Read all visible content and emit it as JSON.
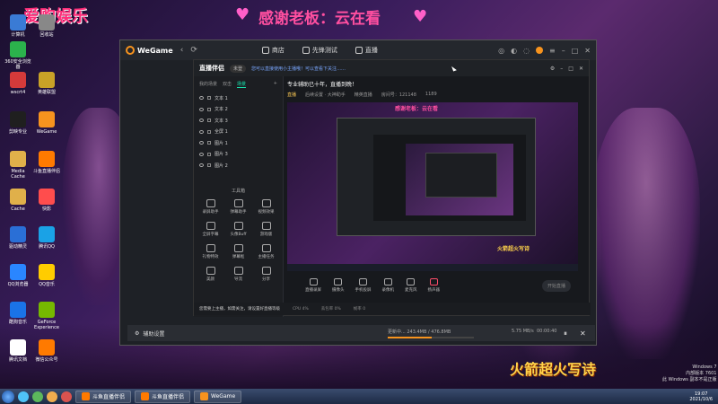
{
  "banners": {
    "left": "爱购娱乐",
    "center": "感谢老板：云在看",
    "right": "火箭超火写诗"
  },
  "desktop_icons": [
    {
      "label": "计算机",
      "color": "#3a7bd5"
    },
    {
      "label": "回收站",
      "color": "#888888"
    },
    {
      "label": "360安全浏览器",
      "color": "#2bb24c"
    },
    {
      "label": "wscrt4",
      "color": "#d53a3a"
    },
    {
      "label": "英雄联盟",
      "color": "#c9a227"
    },
    {
      "label": "剪映专业",
      "color": "#1f1f1f"
    },
    {
      "label": "WeGame",
      "color": "#f7931e"
    },
    {
      "label": "Media Cache",
      "color": "#e0b04a"
    },
    {
      "label": "斗鱼直播伴侣",
      "color": "#ff7a00"
    },
    {
      "label": "Cache",
      "color": "#e0b04a"
    },
    {
      "label": "快影",
      "color": "#ff4d4d"
    },
    {
      "label": "驱动精灵",
      "color": "#2a6fd6"
    },
    {
      "label": "腾讯QQ",
      "color": "#1aa2e6"
    },
    {
      "label": "QQ浏览器",
      "color": "#2a86ff"
    },
    {
      "label": "QQ音乐",
      "color": "#ffcc00"
    },
    {
      "label": "酷狗音乐",
      "color": "#1a73e8"
    },
    {
      "label": "GeForce Experience",
      "color": "#76b900"
    },
    {
      "label": "腾讯文档",
      "color": "#ffffff"
    },
    {
      "label": "微信公众号",
      "color": "#ff7a00"
    }
  ],
  "wegame": {
    "logo": "WeGame",
    "tabs": [
      "商店",
      "先锋测试",
      "直播"
    ],
    "nav_back": "‹",
    "nav_refresh": "⟳"
  },
  "live": {
    "app_name": "直播伴侣",
    "badge": "未登",
    "notice": "您可以直接使用小主播哦！可以查看下关注……",
    "room_title": "专业辅助已十年，直播到晚！",
    "tag": "直播",
    "meta": [
      "后续设置 · 大神助手",
      "精英直播",
      "房间号：121148",
      "1189"
    ],
    "side_tabs": [
      "我的场景",
      "双击",
      "场景"
    ],
    "sources": [
      "文本 1",
      "文本 2",
      "文本 3",
      "全屏 1",
      "图片 1",
      "图片 3",
      "图片 2"
    ],
    "toolbox_title": "工具箱",
    "tools": [
      "录屏助手",
      "弹幕助手",
      "视频效果",
      "全屏字幕",
      "头像Buff",
      "游戏版",
      "礼物特效",
      "弹幕框",
      "主播任务",
      "美颜",
      "导流",
      "分享"
    ],
    "controls": [
      "直播录屏",
      "摄像头",
      "手机投屏",
      "录像机",
      "麦克风",
      "扬声器"
    ],
    "start_label": "开始直播",
    "preview_text_top": "感谢老板：云在看",
    "preview_text_bottom": "火箭超火写诗",
    "foot": [
      "您需要上主播，如需关注，请设置好直播等级",
      "CPU 4%",
      "丢包率 0%",
      "帧率 0"
    ]
  },
  "download": {
    "settings_label": "辅助设置",
    "status_label": "更新中... 243.4MB / 476.8MB",
    "speed": "5.75 MB/s",
    "time": "00:00:40",
    "progress": 0.51,
    "pause": "⏸",
    "close": "✕"
  },
  "windows_version": [
    "Windows 7",
    "内部版本 7601",
    "此 Windows 副本不是正版"
  ],
  "taskbar": {
    "items": [
      {
        "label": "斗鱼直播伴侣",
        "color": "#ff7a00"
      },
      {
        "label": "斗鱼直播伴侣",
        "color": "#ff7a00"
      },
      {
        "label": "WeGame",
        "color": "#f7931e"
      }
    ],
    "clock_time": "19:07",
    "clock_date": "2021/10/6"
  }
}
